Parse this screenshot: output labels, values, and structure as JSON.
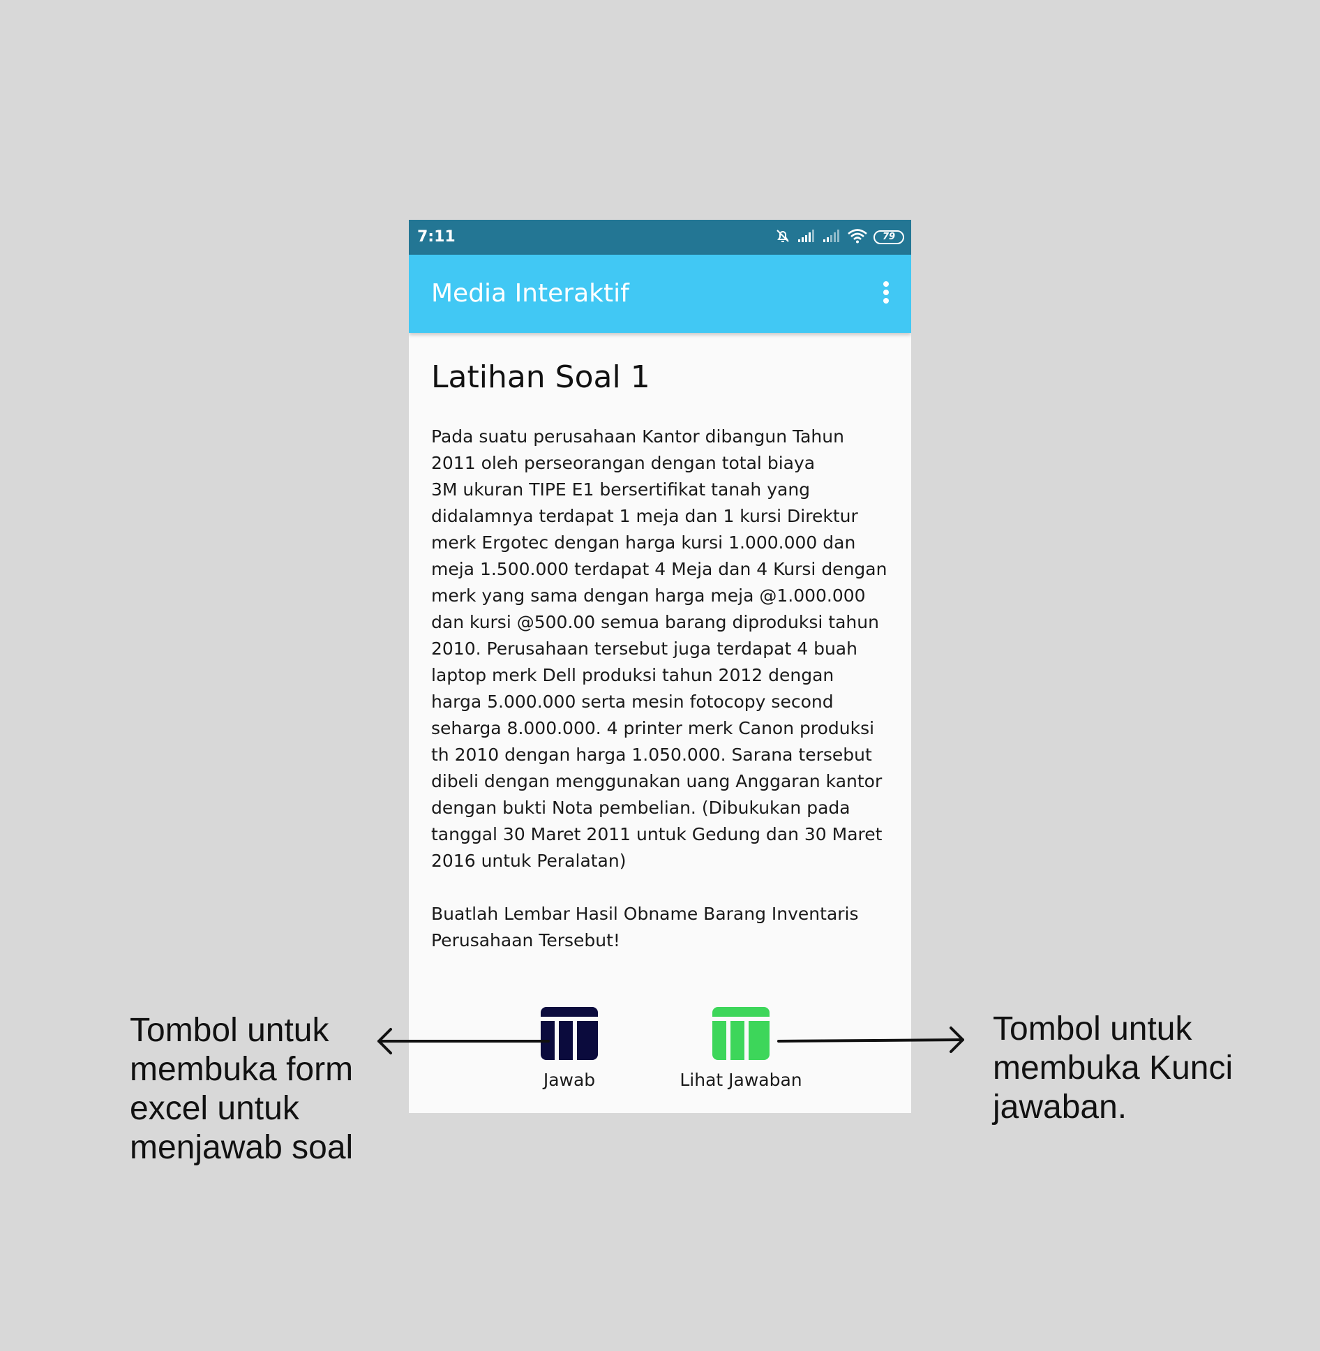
{
  "status_bar": {
    "time": "7:11",
    "battery_level": "79",
    "icons": [
      "mute-bell-icon",
      "signal-icon",
      "signal-icon",
      "wifi-icon",
      "battery-icon"
    ]
  },
  "app_bar": {
    "title": "Media Interaktif",
    "menu_icon": "overflow-menu-icon"
  },
  "content": {
    "title": "Latihan Soal 1",
    "question": "Pada suatu perusahaan Kantor dibangun Tahun\n2011 oleh perseorangan dengan total biaya\n3M ukuran  TIPE E1 bersertifikat tanah yang\ndidalamnya terdapat 1 meja dan 1 kursi Direktur\nmerk Ergotec dengan harga kursi 1.000.000 dan\nmeja 1.500.000 terdapat 4 Meja dan 4 Kursi dengan\nmerk yang sama dengan harga meja @1.000.000\ndan kursi @500.00 semua barang diproduksi tahun\n2010. Perusahaan tersebut juga terdapat 4 buah\nlaptop merk Dell produksi tahun 2012 dengan\nharga 5.000.000 serta mesin fotocopy second\nseharga 8.000.000. 4 printer merk Canon produksi\nth 2010 dengan harga 1.050.000. Sarana tersebut\ndibeli dengan menggunakan uang Anggaran kantor\ndengan bukti Nota pembelian. (Dibukukan pada\ntanggal 30 Maret 2011 untuk Gedung dan 30 Maret\n2016 untuk Peralatan)",
    "instruction": "Buatlah Lembar Hasil Obname Barang Inventaris\nPerusahaan Tersebut!"
  },
  "actions": {
    "jawab": {
      "label": "Jawab",
      "icon": "table-icon",
      "color": "#0b0b3d"
    },
    "lihat_jawaban": {
      "label": "Lihat Jawaban",
      "icon": "table-icon",
      "color": "#3dd65a"
    }
  },
  "callouts": {
    "left": "Tombol untuk\nmembuka form\nexcel untuk\nmenjawab soal",
    "right": "Tombol untuk\nmembuka Kunci\njawaban."
  },
  "colors": {
    "background": "#d8d8d8",
    "status_bar": "#237694",
    "app_bar": "#41c8f4",
    "screen": "#fafafa"
  }
}
